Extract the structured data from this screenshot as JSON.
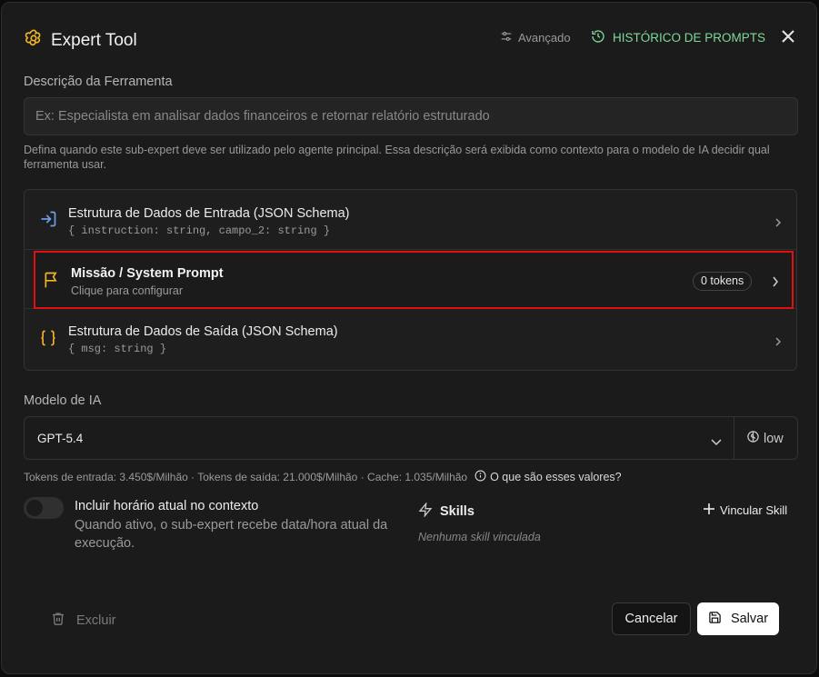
{
  "header": {
    "title": "Expert Tool",
    "advanced_label": "Avançado",
    "history_label": "HISTÓRICO DE PROMPTS"
  },
  "description": {
    "label": "Descrição da Ferramenta",
    "placeholder": "Ex: Especialista em analisar dados financeiros e retornar relatório estruturado",
    "value": "",
    "help": "Defina quando este sub-expert deve ser utilizado pelo agente principal. Essa descrição será exibida como contexto para o modelo de IA decidir qual ferramenta usar."
  },
  "cards": [
    {
      "title": "Estrutura de Dados de Entrada (JSON Schema)",
      "subtitle": "{ instruction: string, campo_2: string }",
      "icon": "login-arrow-icon"
    },
    {
      "title": "Missão / System Prompt",
      "subtitle": "Clique para configurar",
      "badge": "0 tokens",
      "icon": "flag-icon"
    },
    {
      "title": "Estrutura de Dados de Saída (JSON Schema)",
      "subtitle": "{ msg: string }",
      "icon": "braces-icon"
    }
  ],
  "model": {
    "label": "Modelo de IA",
    "selected": "GPT-5.4",
    "effort": "low",
    "pricing": "Tokens de entrada: 3.450$/Milhão · Tokens de saída: 21.000$/Milhão · Cache: 1.035/Milhão",
    "pricing_help": "O que são esses valores?"
  },
  "time_toggle": {
    "title": "Incluir horário atual no contexto",
    "description": "Quando ativo, o sub-expert recebe data/hora atual da execução.",
    "enabled": false
  },
  "skills": {
    "title": "Skills",
    "add_label": "Vincular Skill",
    "empty": "Nenhuma skill vinculada"
  },
  "footer": {
    "delete_label": "Excluir",
    "cancel_label": "Cancelar",
    "save_label": "Salvar"
  },
  "colors": {
    "accent_green": "#7fd89a",
    "icon_yellow": "#f0b429",
    "icon_blue": "#6f9ff0",
    "highlight_red": "#e01010"
  }
}
